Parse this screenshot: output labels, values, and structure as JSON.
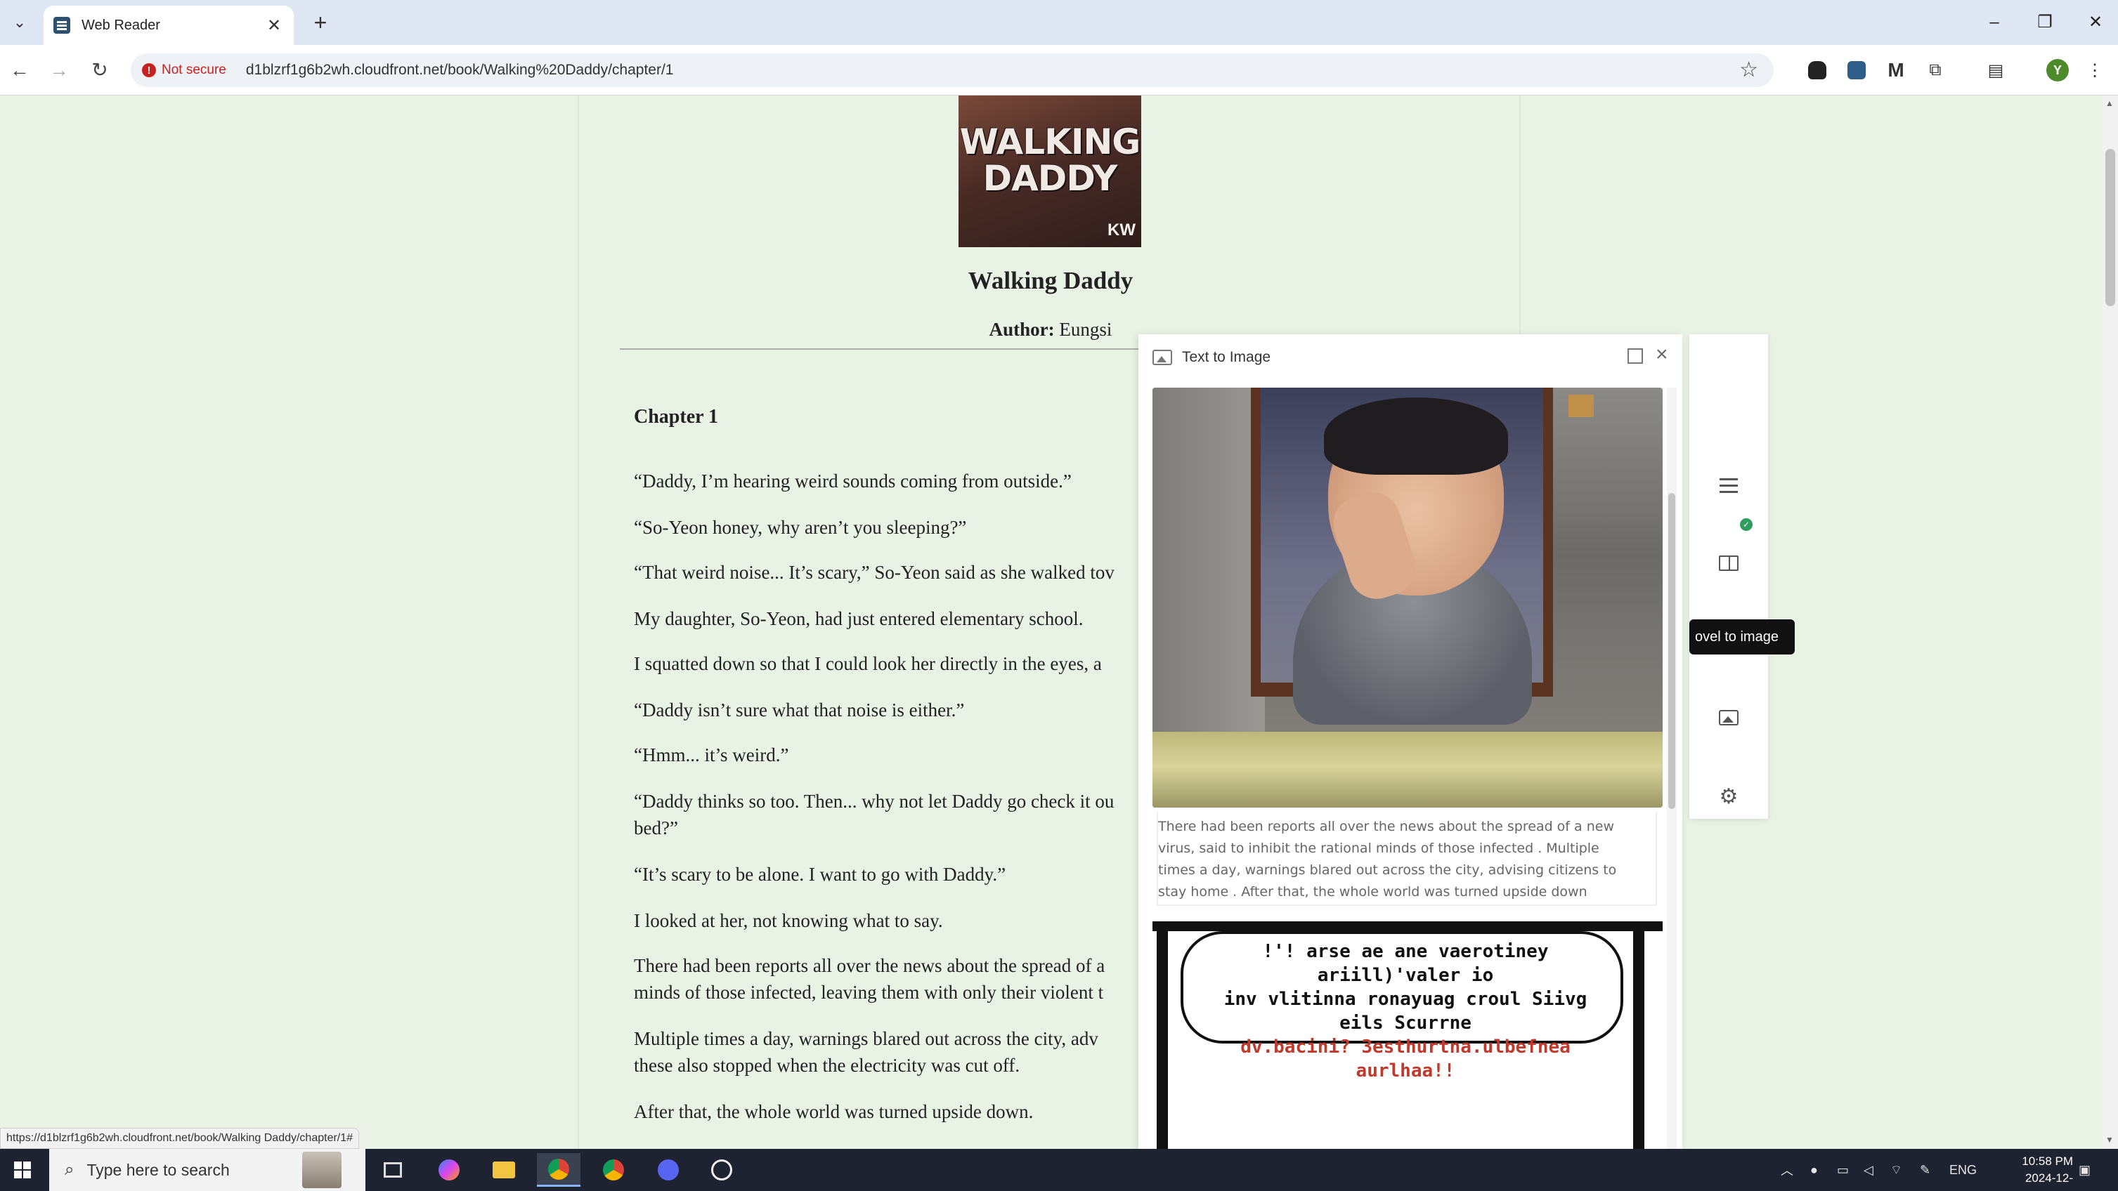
{
  "browser": {
    "tab_title": "Web Reader",
    "tab_close": "✕",
    "new_tab": "+",
    "not_secure_label": "Not secure",
    "url": "d1blzrf1g6b2wh.cloudfront.net/book/Walking%20Daddy/chapter/1",
    "avatar_letter": "Y",
    "extension_letter": "M",
    "status_url": "https://d1blzrf1g6b2wh.cloudfront.net/book/Walking Daddy/chapter/1#"
  },
  "book": {
    "cover_title": "WALKING DADDY",
    "cover_badge": "KW",
    "title": "Walking Daddy",
    "author_label": "Author:",
    "author_name": "Eungsi",
    "chapter_title": "Chapter 1",
    "paragraphs": [
      "“Daddy, I’m hearing weird sounds coming from outside.”",
      "“So-Yeon honey, why aren’t you sleeping?”",
      "“That weird noise... It’s scary,” So-Yeon said as she walked tov",
      "My daughter, So-Yeon, had just entered elementary school.",
      "I squatted down so that I could look her directly in the eyes, a",
      "“Daddy isn’t sure what that noise is either.”",
      "“Hmm... it’s weird.”",
      "“Daddy thinks so too. Then... why not let Daddy go check it ou",
      "bed?”",
      "“It’s scary to be alone. I want to go with Daddy.”",
      "I looked at her, not knowing what to say.",
      "There had been reports all over the news about the spread of a",
      "minds of those infected, leaving them with only their violent t",
      "Multiple times a day, warnings blared out across the city, adv",
      "these also stopped when the electricity was cut off.",
      "After that, the whole world was turned upside down."
    ]
  },
  "text_to_image": {
    "title": "Text to Image",
    "caption_lines": [
      "There had been reports all over the news about the spread of a new",
      "virus, said to inhibit the rational minds of those infected . Multiple",
      "times a day, warnings blared out across the city, advising citizens to",
      "stay home . After that, the whole world was turned upside down"
    ],
    "comic_lines": [
      "!'! arse ae ane vaerotiney ariill)'valer io",
      "inv vlitinna ronayuag croul Siivg eils Scurrne",
      "dv.bacini? 3esthurtna.ulbefnea aurlhaa!!"
    ]
  },
  "side_tools": {
    "tooltip": "ovel to image",
    "badge": "✓"
  },
  "taskbar": {
    "search_placeholder": "Type here to search",
    "language": "ENG",
    "time": "10:58 PM",
    "date": "2024-12-"
  }
}
